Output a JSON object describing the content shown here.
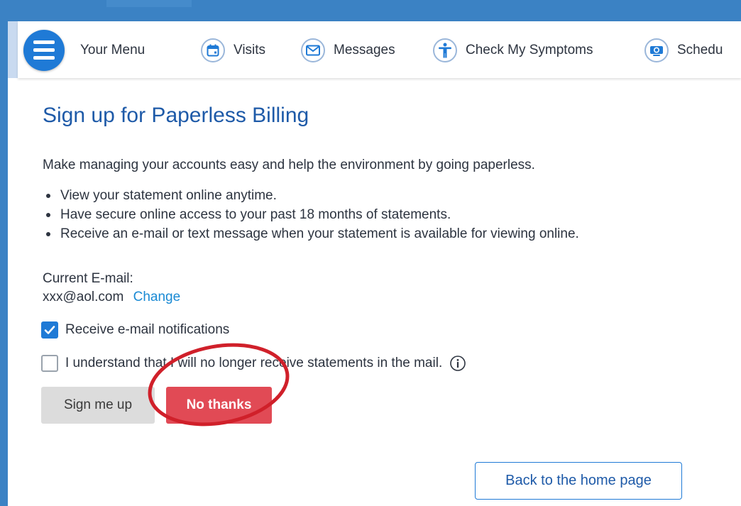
{
  "navbar": {
    "menu_label": "Your Menu",
    "items": [
      {
        "label": "Visits",
        "icon": "calendar-icon"
      },
      {
        "label": "Messages",
        "icon": "envelope-icon"
      },
      {
        "label": "Check My Symptoms",
        "icon": "person-icon"
      },
      {
        "label": "Schedu",
        "icon": "camera-icon"
      }
    ]
  },
  "page": {
    "title": "Sign up for Paperless Billing",
    "intro": "Make managing your accounts easy and help the environment by going paperless.",
    "bullets": [
      "View your statement online anytime.",
      "Have secure online access to your past 18 months of statements.",
      "Receive an e-mail or text message when your statement is available for viewing online."
    ],
    "email_label": "Current E-mail:",
    "email_value": "xxx@aol.com",
    "change_link": "Change",
    "checkbox_notifications": {
      "label": "Receive e-mail notifications",
      "checked": true
    },
    "checkbox_understand": {
      "label": "I understand that I will no longer receive statements in the mail.",
      "checked": false
    },
    "buttons": {
      "sign_up": "Sign me up",
      "no_thanks": "No thanks",
      "back_home": "Back to the home page"
    }
  },
  "colors": {
    "brand_blue": "#3b82c4",
    "title_blue": "#1e5aa8",
    "link_blue": "#1a8ad4",
    "no_thanks_red": "#e14a55",
    "annotation_red": "#d0202a"
  }
}
